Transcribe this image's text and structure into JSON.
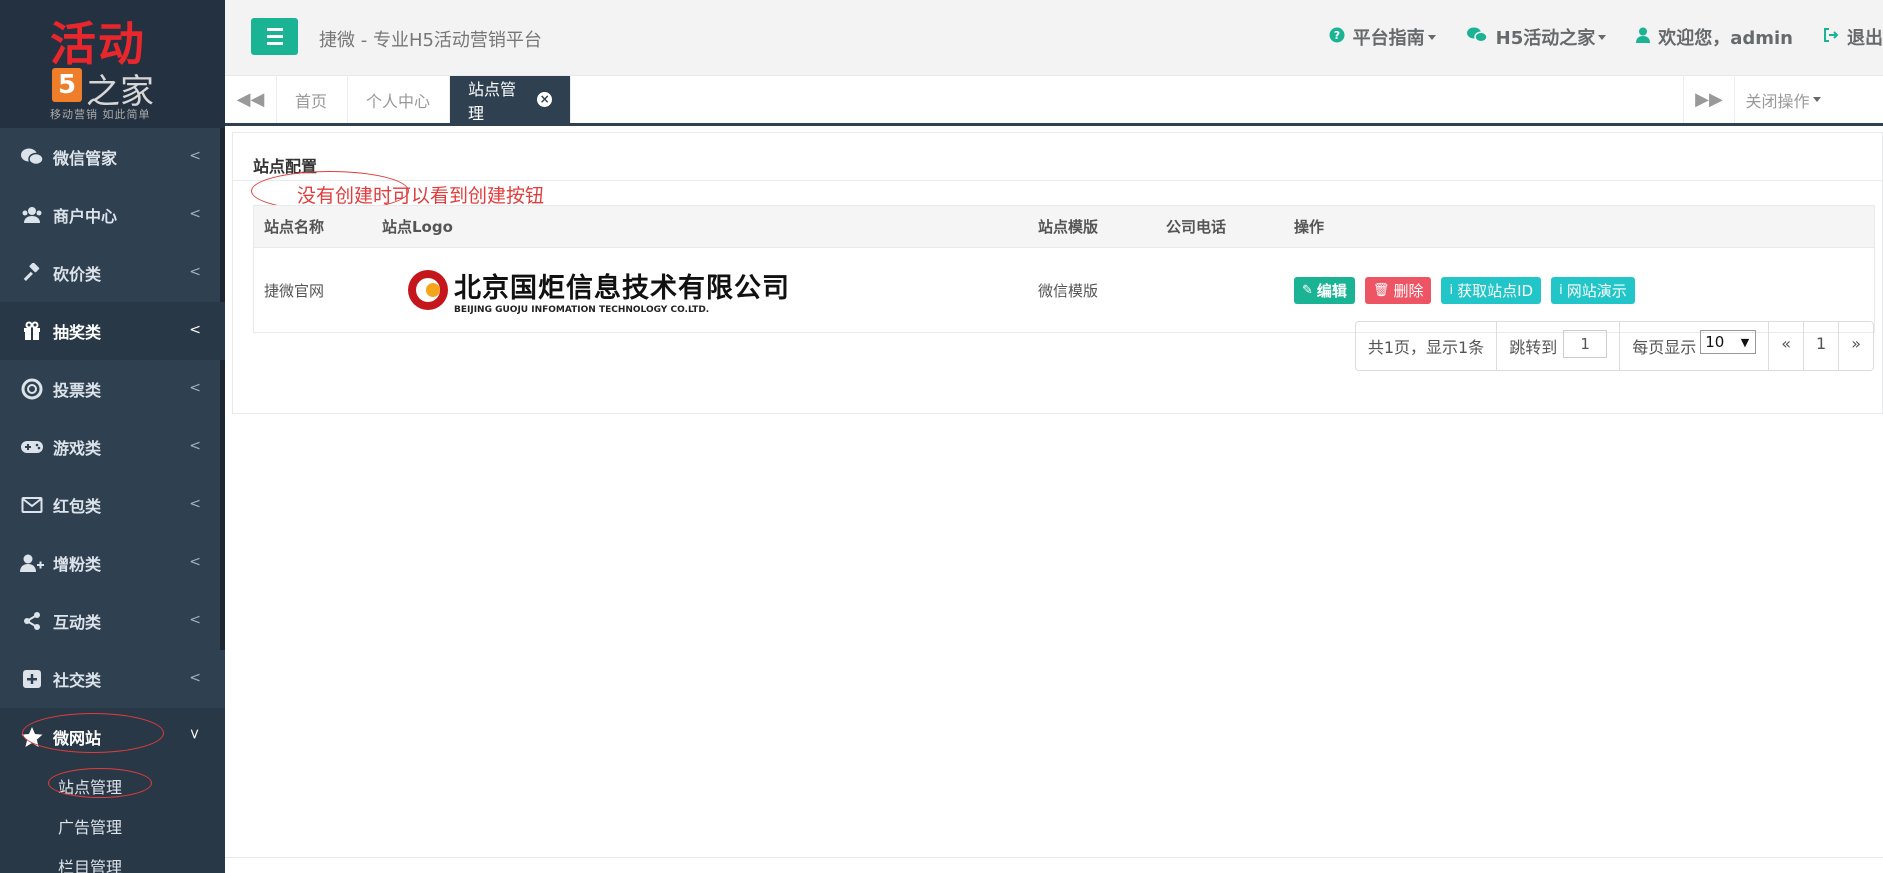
{
  "logo": {
    "main": "活动",
    "five": "5",
    "sub": "之家",
    "slogan": "移动营销 如此简单"
  },
  "sidebar": {
    "items": [
      {
        "label": "微信管家",
        "icon": "wechat-icon"
      },
      {
        "label": "商户中心",
        "icon": "users-icon"
      },
      {
        "label": "砍价类",
        "icon": "gavel-icon"
      },
      {
        "label": "抽奖类",
        "icon": "gift-icon"
      },
      {
        "label": "投票类",
        "icon": "lifebuoy-icon"
      },
      {
        "label": "游戏类",
        "icon": "gamepad-icon"
      },
      {
        "label": "红包类",
        "icon": "envelope-icon"
      },
      {
        "label": "增粉类",
        "icon": "user-plus-icon"
      },
      {
        "label": "互动类",
        "icon": "share-icon"
      },
      {
        "label": "社交类",
        "icon": "plus-square-icon"
      },
      {
        "label": "微网站",
        "icon": "star-icon"
      }
    ],
    "sub_items": [
      "站点管理",
      "广告管理",
      "栏目管理"
    ]
  },
  "topbar": {
    "title": "捷微 - 专业H5活动营销平台",
    "guide": "平台指南",
    "h5home": "H5活动之家",
    "welcome": "欢迎您，admin",
    "logout": "退出"
  },
  "tabs": {
    "home": "首页",
    "profile": "个人中心",
    "site": "站点管理",
    "close_ops": "关闭操作"
  },
  "panel": {
    "title": "站点配置",
    "annotation": "没有创建时可以看到创建按钮",
    "headers": [
      "站点名称",
      "站点Logo",
      "站点模版",
      "公司电话",
      "操作"
    ],
    "row": {
      "name": "捷微官网",
      "logo_cn": "北京国炬信息技术有限公司",
      "logo_en": "BEIJING GUOJU INFOMATION TECHNOLOGY CO.LTD.",
      "template": "微信模版",
      "phone": ""
    },
    "actions": {
      "edit": "编辑",
      "delete": "删除",
      "get_id": "获取站点ID",
      "demo": "网站演示"
    }
  },
  "pager": {
    "summary": "共1页，显示1条",
    "jump_label": "跳转到",
    "jump_value": "1",
    "per_page_label": "每页显示",
    "per_page_value": "10",
    "prev": "«",
    "page": "1",
    "next": "»"
  },
  "colors": {
    "sidebar": "#2f4050",
    "primary": "#1ab394",
    "danger": "#ed5565",
    "info": "#23c6c8",
    "annotation": "#e23c3c"
  }
}
